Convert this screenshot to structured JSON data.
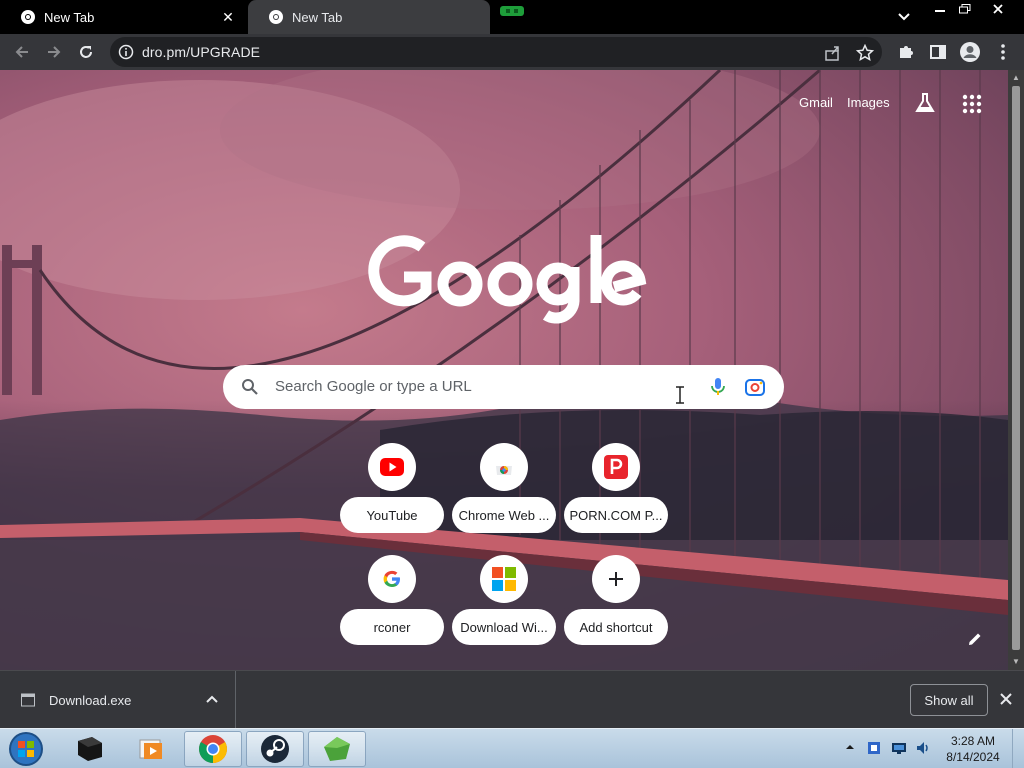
{
  "tabs": [
    {
      "title": "New Tab",
      "active": true
    },
    {
      "title": "New Tab",
      "active": false
    }
  ],
  "omnibox": {
    "url": "dro.pm/UPGRADE"
  },
  "ntp": {
    "links": {
      "gmail": "Gmail",
      "images": "Images"
    },
    "search_placeholder": "Search Google or type a URL",
    "shortcuts": [
      {
        "label": "YouTube",
        "icon": "youtube-icon"
      },
      {
        "label": "Chrome Web ...",
        "icon": "chrome-web-store-icon"
      },
      {
        "label": "PORN.COM P...",
        "icon": "porn-com-icon"
      },
      {
        "label": "rconer",
        "icon": "google-icon"
      },
      {
        "label": "Download Wi...",
        "icon": "microsoft-icon"
      },
      {
        "label": "Add shortcut",
        "icon": "plus-icon"
      }
    ]
  },
  "download_bar": {
    "file_name": "Download.exe",
    "show_all_label": "Show all"
  },
  "taskbar": {
    "time": "3:28 AM",
    "date": "8/14/2024"
  },
  "colors": {
    "youtube_red": "#ff0000",
    "porn_red": "#e8242c",
    "google_blue": "#4285f4",
    "lens_blue": "#1a73e8"
  }
}
